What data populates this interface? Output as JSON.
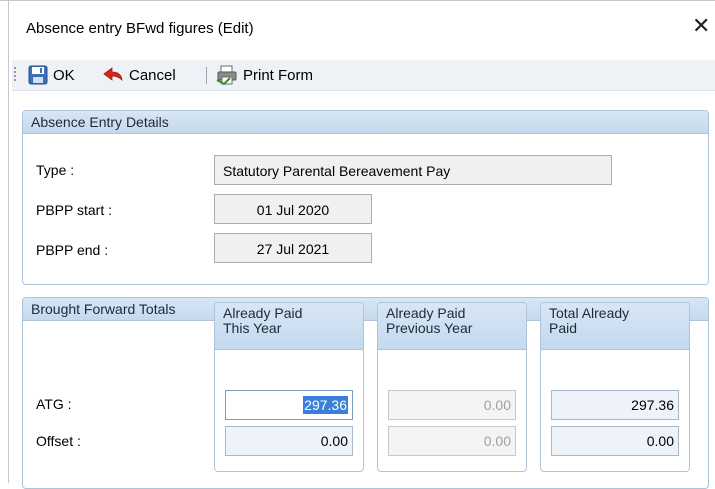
{
  "window": {
    "title": "Absence entry BFwd figures (Edit)",
    "close_glyph": "✕"
  },
  "toolbar": {
    "ok_label": "OK",
    "cancel_label": "Cancel",
    "print_label": "Print Form",
    "icons": {
      "ok": "save-disk-icon",
      "cancel": "undo-arrow-icon",
      "print": "print-form-icon"
    }
  },
  "details": {
    "header": "Absence Entry Details",
    "type_label": "Type :",
    "type_value": "Statutory Parental Bereavement Pay",
    "start_label": "PBPP start :",
    "start_value": "01 Jul 2020",
    "end_label": "PBPP end :",
    "end_value": "27 Jul 2021"
  },
  "totals": {
    "header": "Brought Forward Totals",
    "row_labels": {
      "atg": "ATG :",
      "offset": "Offset :"
    },
    "columns": [
      {
        "line1": "Already Paid",
        "line2": "This Year",
        "atg": "297.36",
        "offset": "0.00"
      },
      {
        "line1": "Already Paid",
        "line2": "Previous Year",
        "atg": "0.00",
        "offset": "0.00"
      },
      {
        "line1": "Total Already",
        "line2": "Paid",
        "atg": "297.36",
        "offset": "0.00"
      }
    ]
  },
  "colors": {
    "group_header": "#c9dcef",
    "selection": "#3a80d9",
    "readonly_bg": "#f0f0f0"
  }
}
